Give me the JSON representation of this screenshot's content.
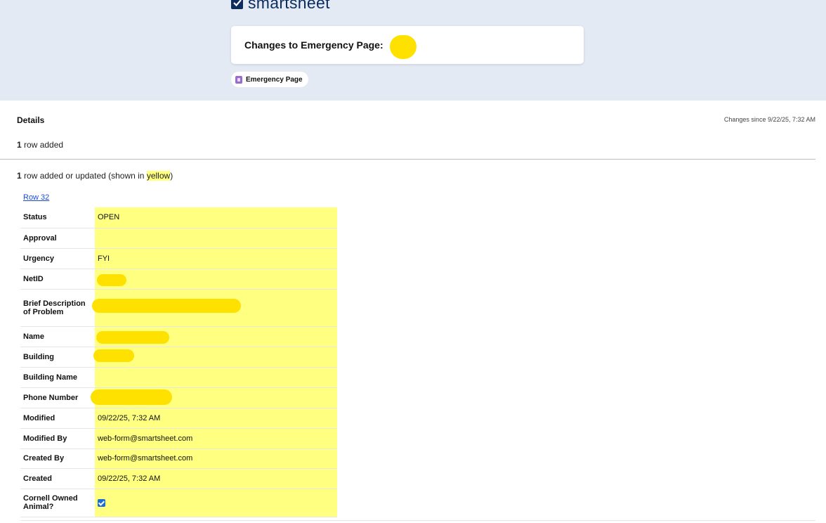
{
  "brand": {
    "name": "smartsheet",
    "color": "#0c2d5e"
  },
  "header": {
    "title": "Changes to Emergency Page:",
    "sheet_chip": "Emergency Page"
  },
  "details": {
    "label": "Details",
    "changes_since": "Changes since 9/22/25, 7:32 AM",
    "summary_count": "1",
    "summary_text": "row added",
    "updated_count": "1",
    "updated_text_before": "row added or updated (shown in",
    "updated_highlight": "yellow",
    "updated_text_after": ")",
    "highlight_color": "#ffff80"
  },
  "row": {
    "link_label": "Row 32",
    "fields": [
      {
        "label": "Status",
        "value": "OPEN"
      },
      {
        "label": "Approval",
        "value": ""
      },
      {
        "label": "Urgency",
        "value": "FYI"
      },
      {
        "label": "NetID",
        "value": ""
      },
      {
        "label": "Brief Description of Problem",
        "value": ""
      },
      {
        "label": "Name",
        "value": ""
      },
      {
        "label": "Building",
        "value": ""
      },
      {
        "label": "Building Name",
        "value": ""
      },
      {
        "label": "Phone Number",
        "value": ""
      },
      {
        "label": "Modified",
        "value": "09/22/25, 7:32 AM"
      },
      {
        "label": "Modified By",
        "value": "web-form@smartsheet.com"
      },
      {
        "label": "Created By",
        "value": "web-form@smartsheet.com"
      },
      {
        "label": "Created",
        "value": "09/22/25, 7:32 AM"
      },
      {
        "label": "Cornell Owned Animal?",
        "value": "",
        "checked": true
      }
    ]
  }
}
